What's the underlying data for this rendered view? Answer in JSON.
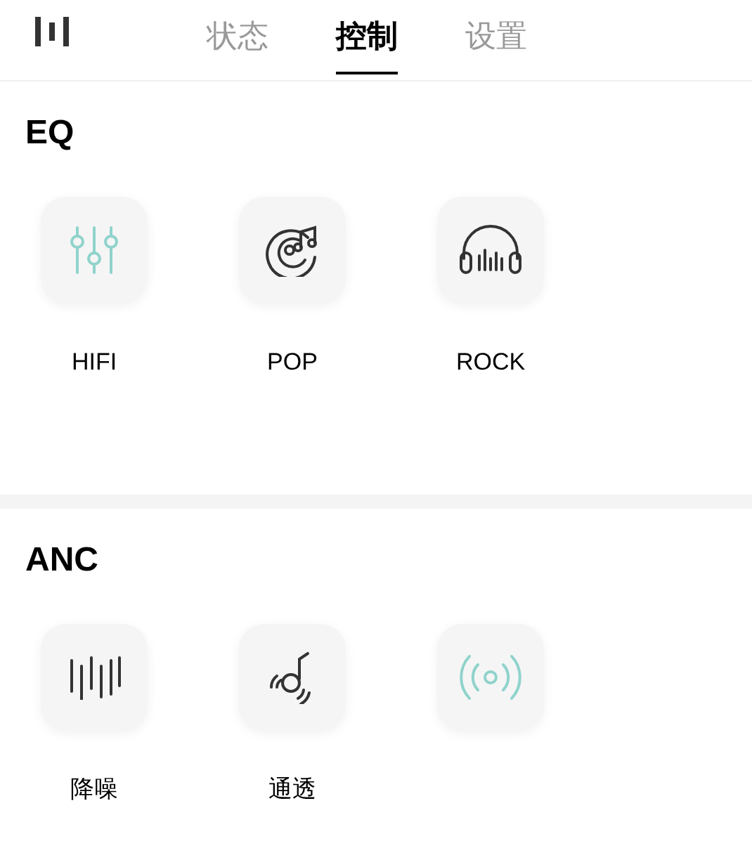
{
  "tabs": [
    {
      "label": "状态",
      "selected": false
    },
    {
      "label": "控制",
      "selected": true
    },
    {
      "label": "设置",
      "selected": false
    }
  ],
  "sections": [
    {
      "title": "EQ",
      "items": [
        {
          "kind": "sliders",
          "label": "HIFI",
          "selected": true
        },
        {
          "kind": "disc",
          "label": "POP",
          "selected": false
        },
        {
          "kind": "headphones",
          "label": "ROCK",
          "selected": false
        }
      ]
    },
    {
      "title": "ANC",
      "items": [
        {
          "kind": "bars",
          "label": "降噪",
          "selected": false
        },
        {
          "kind": "transparency",
          "label": "通透",
          "selected": false
        },
        {
          "kind": "signal",
          "selected": true
        }
      ]
    }
  ]
}
